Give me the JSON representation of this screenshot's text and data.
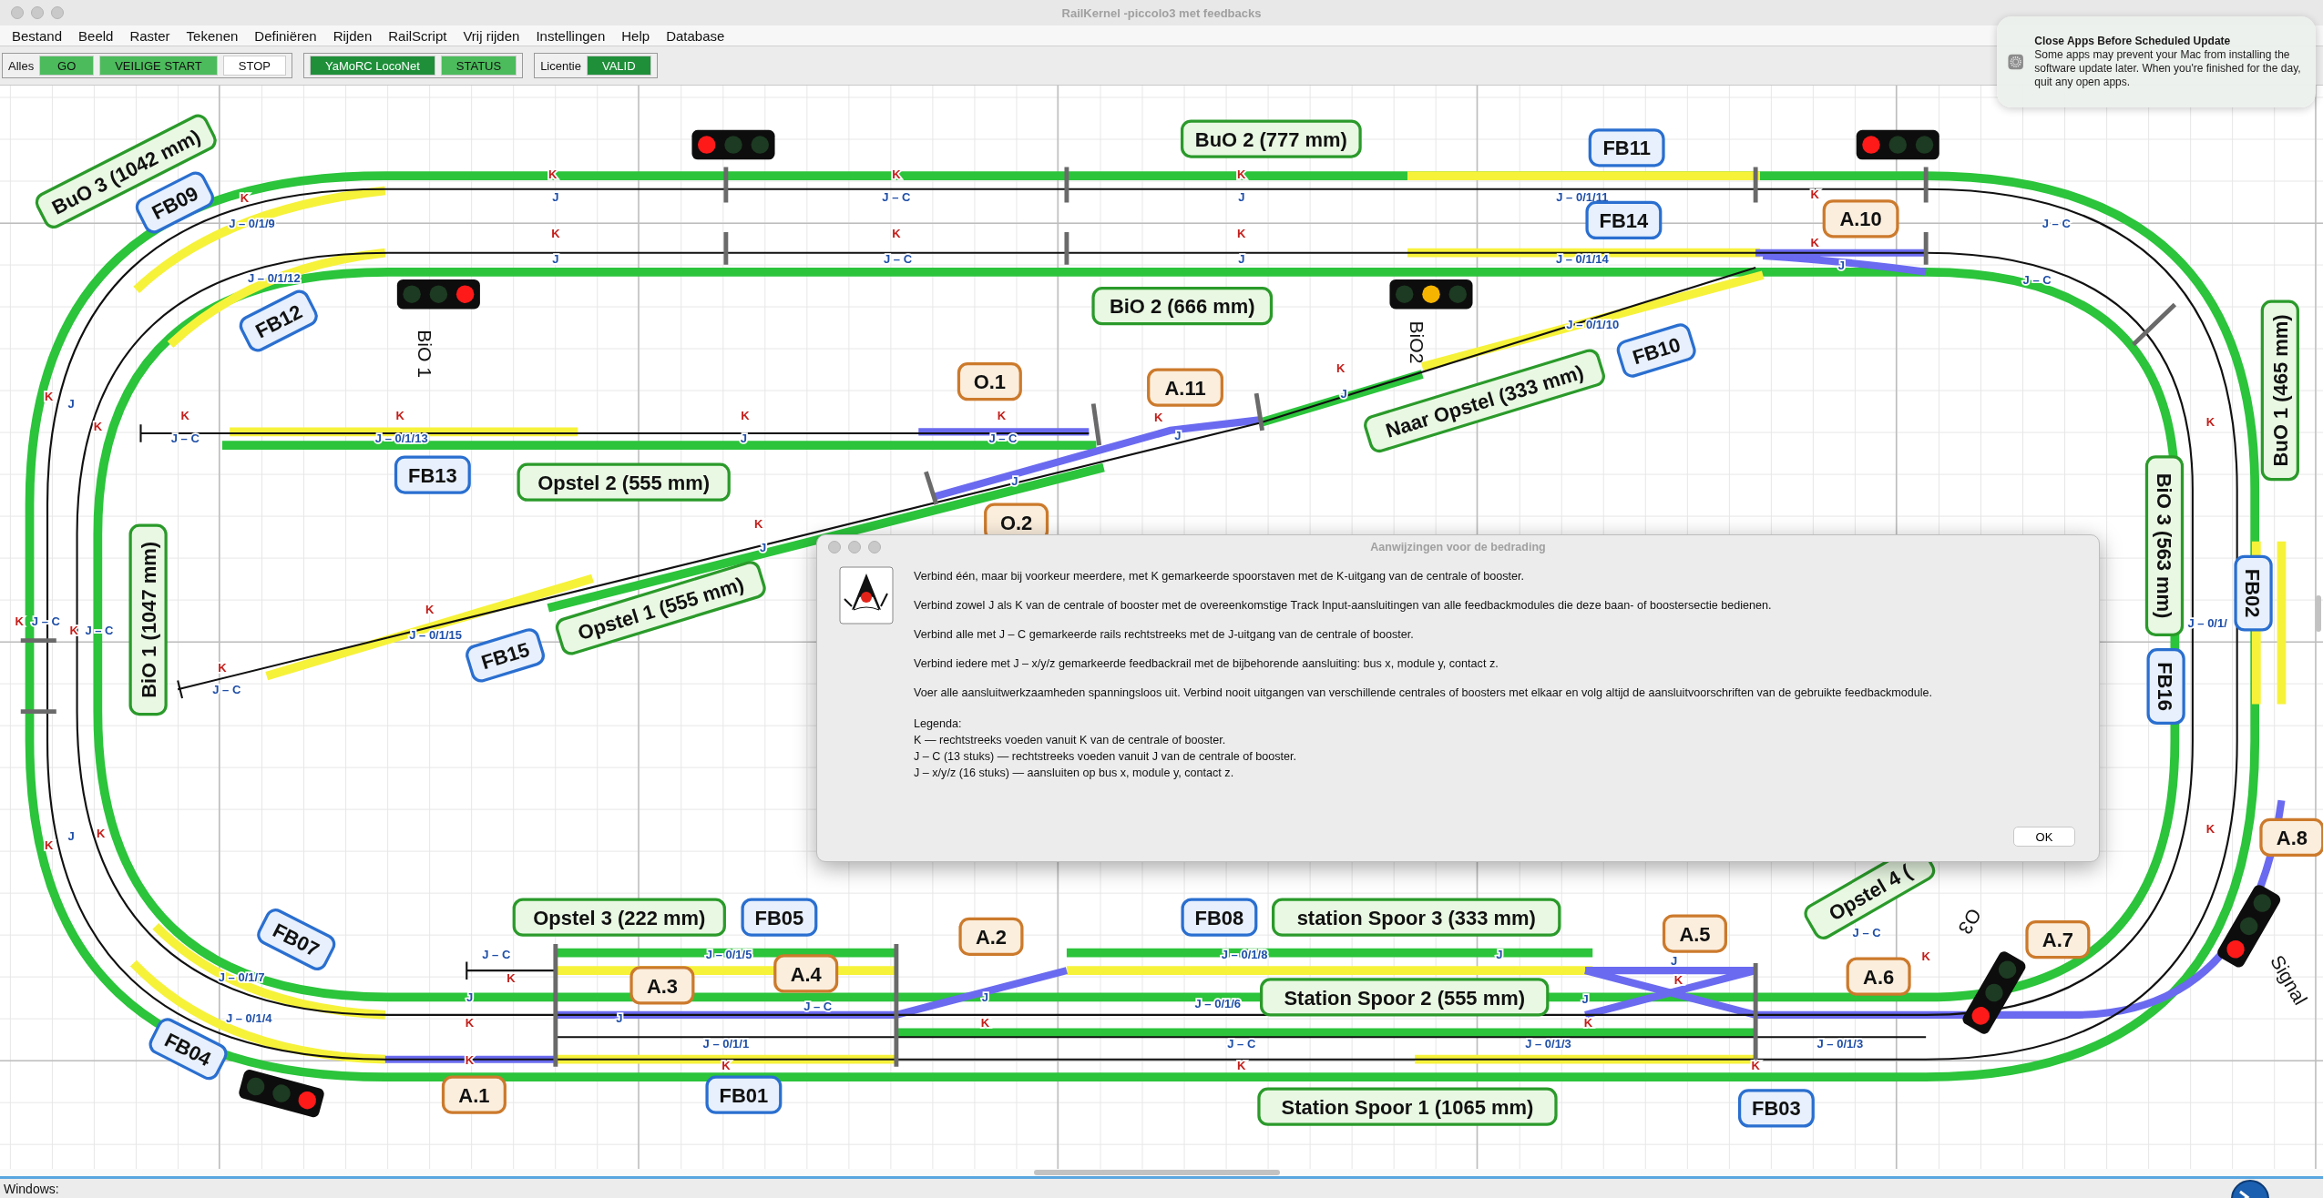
{
  "window": {
    "title": "RailKernel -piccolo3 met feedbacks"
  },
  "menu": [
    "Bestand",
    "Beeld",
    "Raster",
    "Tekenen",
    "Definiëren",
    "Rijden",
    "RailScript",
    "Vrij rijden",
    "Instellingen",
    "Help",
    "Database"
  ],
  "toolbar": [
    {
      "label": "Alles",
      "buttons": [
        {
          "text": "GO",
          "color": "#4cbb5c"
        },
        {
          "text": "VEILIGE START",
          "color": "#4cbb5c"
        },
        {
          "text": "STOP",
          "color": "#ffffff"
        }
      ]
    },
    {
      "buttons": [
        {
          "text": "YaMoRC LocoNet",
          "color": "#1f8f3a"
        },
        {
          "text": "STATUS",
          "color": "#4cbb5c"
        }
      ]
    },
    {
      "label": "Licentie",
      "buttons": [
        {
          "text": "VALID",
          "color": "#1f8f3a"
        }
      ]
    }
  ],
  "layout": {
    "labels": [
      {
        "text": "BuO 3 (1042 mm)",
        "kind": "section"
      },
      {
        "text": "BuO 2 (777 mm)",
        "kind": "section"
      },
      {
        "text": "BiO 2 (666 mm)",
        "kind": "section"
      },
      {
        "text": "Naar Opstel (333 mm)",
        "kind": "section"
      },
      {
        "text": "Opstel 2 (555 mm)",
        "kind": "section"
      },
      {
        "text": "Opstel 1 (555 mm)",
        "kind": "section"
      },
      {
        "text": "BiO 1 (1047 mm)",
        "kind": "section"
      },
      {
        "text": "BiO 3 (563 mm)",
        "kind": "section"
      },
      {
        "text": "BuO 1 (465 mm)",
        "kind": "section"
      },
      {
        "text": "Opstel 3 (222 mm)",
        "kind": "section"
      },
      {
        "text": "station Spoor 3 (333 mm)",
        "kind": "section"
      },
      {
        "text": "Station Spoor 2 (555 mm)",
        "kind": "section"
      },
      {
        "text": "Station Spoor 1 (1065 mm)",
        "kind": "section"
      },
      {
        "text": "Opstel 4 (",
        "kind": "section"
      },
      {
        "text": "FB09",
        "kind": "feedback"
      },
      {
        "text": "FB11",
        "kind": "feedback"
      },
      {
        "text": "FB14",
        "kind": "feedback"
      },
      {
        "text": "FB12",
        "kind": "feedback"
      },
      {
        "text": "FB10",
        "kind": "feedback"
      },
      {
        "text": "FB13",
        "kind": "feedback"
      },
      {
        "text": "FB15",
        "kind": "feedback"
      },
      {
        "text": "FB16",
        "kind": "feedback"
      },
      {
        "text": "FB02",
        "kind": "feedback"
      },
      {
        "text": "FB05",
        "kind": "feedback"
      },
      {
        "text": "FB08",
        "kind": "feedback"
      },
      {
        "text": "FB07",
        "kind": "feedback"
      },
      {
        "text": "FB04",
        "kind": "feedback"
      },
      {
        "text": "FB01",
        "kind": "feedback"
      },
      {
        "text": "FB03",
        "kind": "feedback"
      },
      {
        "text": "A.10",
        "kind": "turnout"
      },
      {
        "text": "O.1",
        "kind": "turnout"
      },
      {
        "text": "A.11",
        "kind": "turnout"
      },
      {
        "text": "O.2",
        "kind": "turnout"
      },
      {
        "text": "A.3",
        "kind": "turnout"
      },
      {
        "text": "A.4",
        "kind": "turnout"
      },
      {
        "text": "A.2",
        "kind": "turnout"
      },
      {
        "text": "A.5",
        "kind": "turnout"
      },
      {
        "text": "A.6",
        "kind": "turnout"
      },
      {
        "text": "A.7",
        "kind": "turnout"
      },
      {
        "text": "A.8",
        "kind": "turnout"
      },
      {
        "text": "A.1",
        "kind": "turnout"
      }
    ],
    "signals": [
      {
        "lamps": [
          {
            "color": "#ff1a1a"
          },
          {
            "color": "#1d3a22"
          },
          {
            "color": "#1d3a22"
          }
        ]
      },
      {
        "lamps": [
          {
            "color": "#ff1a1a"
          },
          {
            "color": "#1d3a22"
          },
          {
            "color": "#1d3a22"
          }
        ]
      },
      {
        "lamps": [
          {
            "color": "#1d3a22"
          },
          {
            "color": "#1d3a22"
          },
          {
            "color": "#ff1a1a"
          }
        ]
      },
      {
        "lamps": [
          {
            "color": "#1d3a22"
          },
          {
            "color": "#f5b400"
          },
          {
            "color": "#1d3a22"
          }
        ]
      },
      {
        "lamps": [
          {
            "color": "#1d3a22"
          },
          {
            "color": "#1d3a22"
          },
          {
            "color": "#ff1a1a"
          }
        ]
      },
      {
        "lamps": [
          {
            "color": "#ff1a1a"
          },
          {
            "color": "#1d3a22"
          },
          {
            "color": "#1d3a22"
          }
        ]
      },
      {
        "lamps": [
          {
            "color": "#ff1a1a"
          },
          {
            "color": "#1d3a22"
          },
          {
            "color": "#1d3a22"
          }
        ]
      }
    ],
    "signal_labels": [
      "BiO 1",
      "BiO2",
      "O3",
      "Signal"
    ],
    "track_marks": [
      {
        "text": "K",
        "kind": "k"
      },
      {
        "text": "J – 0/1/9",
        "kind": "j"
      },
      {
        "text": "K",
        "kind": "k"
      },
      {
        "text": "J",
        "kind": "j"
      },
      {
        "text": "K",
        "kind": "k"
      },
      {
        "text": "J – C",
        "kind": "j"
      },
      {
        "text": "K",
        "kind": "k"
      },
      {
        "text": "J",
        "kind": "j"
      },
      {
        "text": "J – 0/1/11",
        "kind": "j"
      },
      {
        "text": "K",
        "kind": "k"
      },
      {
        "text": "J – C",
        "kind": "j"
      },
      {
        "text": "K",
        "kind": "k"
      },
      {
        "text": "J",
        "kind": "j"
      },
      {
        "text": "K",
        "kind": "k"
      },
      {
        "text": "J – C",
        "kind": "j"
      },
      {
        "text": "K",
        "kind": "k"
      },
      {
        "text": "J",
        "kind": "j"
      },
      {
        "text": "J – 0/1/14",
        "kind": "j"
      },
      {
        "text": "K",
        "kind": "k"
      },
      {
        "text": "J",
        "kind": "j"
      },
      {
        "text": "J – C",
        "kind": "j"
      },
      {
        "text": "J – 0/1/12",
        "kind": "j"
      },
      {
        "text": "J – 0/1/10",
        "kind": "j"
      },
      {
        "text": "K",
        "kind": "k"
      },
      {
        "text": "J",
        "kind": "j"
      },
      {
        "text": "K",
        "kind": "k"
      },
      {
        "text": "J – C",
        "kind": "j"
      },
      {
        "text": "K",
        "kind": "k"
      },
      {
        "text": "J – 0/1/13",
        "kind": "j"
      },
      {
        "text": "K",
        "kind": "k"
      },
      {
        "text": "J",
        "kind": "j"
      },
      {
        "text": "K",
        "kind": "k"
      },
      {
        "text": "J – C",
        "kind": "j"
      },
      {
        "text": "K",
        "kind": "k"
      },
      {
        "text": "J",
        "kind": "j"
      },
      {
        "text": "J",
        "kind": "j"
      },
      {
        "text": "K",
        "kind": "k"
      },
      {
        "text": "J",
        "kind": "j"
      },
      {
        "text": "K",
        "kind": "k"
      },
      {
        "text": "K",
        "kind": "k"
      },
      {
        "text": "J",
        "kind": "j"
      },
      {
        "text": "K",
        "kind": "k"
      },
      {
        "text": "J – 0/1/15",
        "kind": "j"
      },
      {
        "text": "K",
        "kind": "k"
      },
      {
        "text": "J – C",
        "kind": "j"
      },
      {
        "text": "K",
        "kind": "k"
      },
      {
        "text": "J – C",
        "kind": "j"
      },
      {
        "text": "K",
        "kind": "k"
      },
      {
        "text": "J – C",
        "kind": "j"
      },
      {
        "text": "K",
        "kind": "k"
      },
      {
        "text": "K",
        "kind": "k"
      },
      {
        "text": "J",
        "kind": "j"
      },
      {
        "text": "K",
        "kind": "k"
      },
      {
        "text": "J – 0/1/7",
        "kind": "j"
      },
      {
        "text": "J – 0/1/4",
        "kind": "j"
      },
      {
        "text": "J – C",
        "kind": "j"
      },
      {
        "text": "K",
        "kind": "k"
      },
      {
        "text": "J",
        "kind": "j"
      },
      {
        "text": "K",
        "kind": "k"
      },
      {
        "text": "K",
        "kind": "k"
      },
      {
        "text": "J – 0/1/5",
        "kind": "j"
      },
      {
        "text": "J",
        "kind": "j"
      },
      {
        "text": "J – C",
        "kind": "j"
      },
      {
        "text": "J – 0/1/1",
        "kind": "j"
      },
      {
        "text": "K",
        "kind": "k"
      },
      {
        "text": "J",
        "kind": "j"
      },
      {
        "text": "K",
        "kind": "k"
      },
      {
        "text": "J – 0/1/8",
        "kind": "j"
      },
      {
        "text": "J – 0/1/6",
        "kind": "j"
      },
      {
        "text": "J – C",
        "kind": "j"
      },
      {
        "text": "K",
        "kind": "k"
      },
      {
        "text": "J",
        "kind": "j"
      },
      {
        "text": "J – 0/1/3",
        "kind": "j"
      },
      {
        "text": "J – 0/1/3",
        "kind": "j"
      },
      {
        "text": "K",
        "kind": "k"
      },
      {
        "text": "J",
        "kind": "j"
      },
      {
        "text": "K",
        "kind": "k"
      },
      {
        "text": "J – C",
        "kind": "j"
      },
      {
        "text": "K",
        "kind": "k"
      },
      {
        "text": "J – 0/1/",
        "kind": "j"
      },
      {
        "text": "K",
        "kind": "k"
      },
      {
        "text": "J",
        "kind": "j"
      },
      {
        "text": "K",
        "kind": "k"
      }
    ]
  },
  "dialog": {
    "title": "Aanwijzingen voor de bedrading",
    "paragraphs": [
      "Verbind één, maar bij voorkeur meerdere, met K gemarkeerde spoorstaven met de K-uitgang van de centrale of booster.",
      "Verbind zowel J als K van de centrale of booster met de overeenkomstige Track Input-aansluitingen van alle feedbackmodules die deze baan- of boostersectie bedienen.",
      "Verbind alle met J – C gemarkeerde rails rechtstreeks met de J-uitgang van de centrale of booster.",
      "Verbind iedere met J – x/y/z gemarkeerde feedbackrail met de bijbehorende aansluiting: bus x, module y, contact z.",
      "Voer alle aansluitwerkzaamheden spanningsloos uit. Verbind nooit uitgangen van verschillende centrales of boosters met elkaar en volg altijd de aansluitvoorschriften van de gebruikte feedbackmodule."
    ],
    "legend_title": "Legenda:",
    "legend": [
      "K — rechtstreeks voeden vanuit K van de centrale of booster.",
      "J – C (13 stuks) — rechtstreeks voeden vanuit J van de centrale of booster.",
      "J – x/y/z (16 stuks) — aansluiten op bus x, module y, contact z."
    ],
    "button": "OK"
  },
  "notification": {
    "title": "Close Apps Before Scheduled Update",
    "body": "Some apps may prevent your Mac from installing the software update later. When you're finished for the day, quit any open apps."
  },
  "status_bar": {
    "text": "Windows:"
  }
}
